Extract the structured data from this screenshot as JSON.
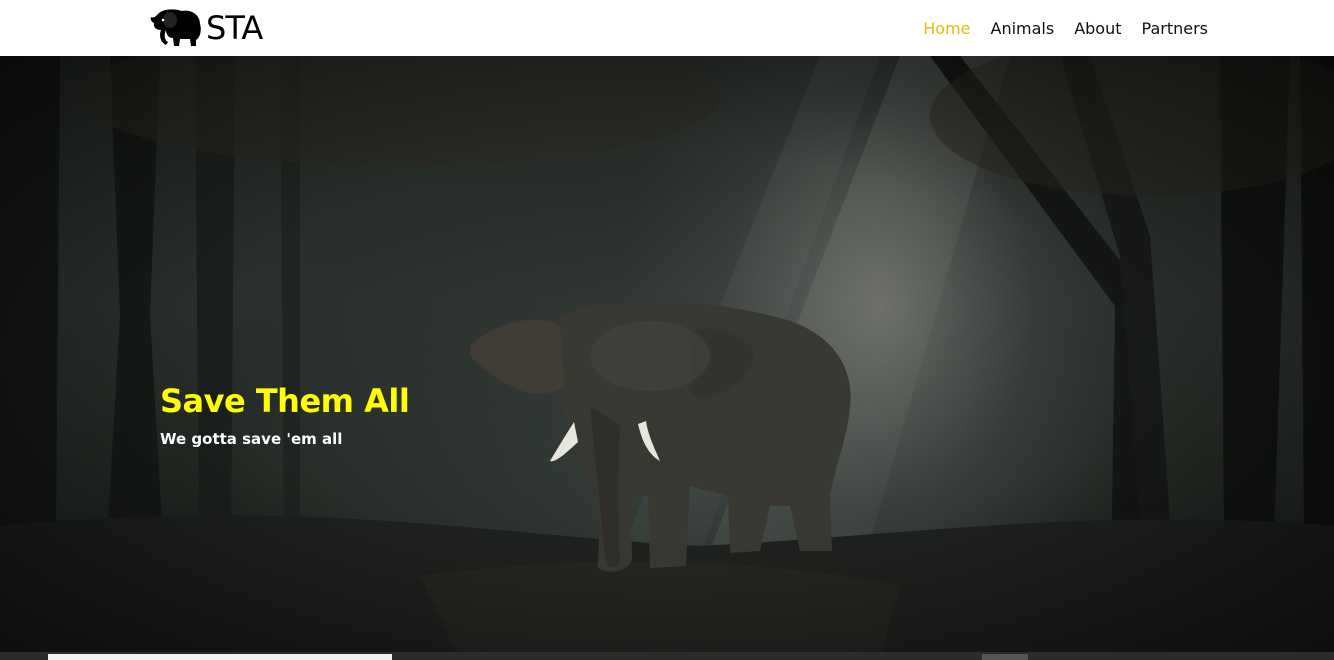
{
  "brand": {
    "logo_icon": "elephant-icon",
    "name": "STA"
  },
  "nav": {
    "items": [
      {
        "label": "Home",
        "active": true
      },
      {
        "label": "Animals",
        "active": false
      },
      {
        "label": "About",
        "active": false
      },
      {
        "label": "Partners",
        "active": false
      }
    ],
    "active_color": "#f0b90b"
  },
  "hero": {
    "title": "Save Them All",
    "subtitle": "We gotta save 'em all",
    "title_color": "#ffff00",
    "background": "forest-elephant-photo"
  }
}
